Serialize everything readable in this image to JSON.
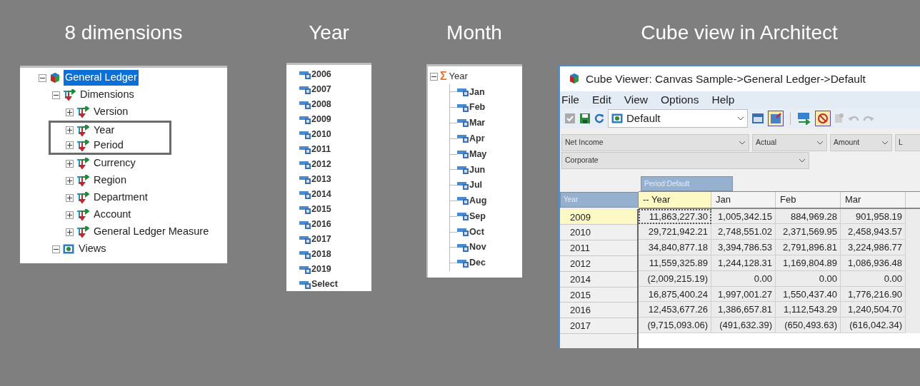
{
  "headings": [
    "8 dimensions",
    "Year",
    "Month",
    "Cube view in Architect"
  ],
  "tree": [
    {
      "label": "General Ledger",
      "kind": "cube",
      "selected": true,
      "expanded": true,
      "highlighted": false,
      "children": [
        {
          "label": "Dimensions",
          "kind": "dimension",
          "selected": false,
          "expanded": true,
          "highlighted": false,
          "children": [
            {
              "label": "Version",
              "kind": "dimension",
              "selected": false,
              "expanded": false,
              "highlighted": false
            },
            {
              "label": "Year",
              "kind": "dimension",
              "selected": false,
              "expanded": false,
              "highlighted": true
            },
            {
              "label": "Period",
              "kind": "dimension",
              "selected": false,
              "expanded": false,
              "highlighted": true
            },
            {
              "label": "Currency",
              "kind": "dimension",
              "selected": false,
              "expanded": false,
              "highlighted": false
            },
            {
              "label": "Region",
              "kind": "dimension",
              "selected": false,
              "expanded": false,
              "highlighted": false
            },
            {
              "label": "Department",
              "kind": "dimension",
              "selected": false,
              "expanded": false,
              "highlighted": false
            },
            {
              "label": "Account",
              "kind": "dimension",
              "selected": false,
              "expanded": false,
              "highlighted": false
            },
            {
              "label": "General Ledger Measure",
              "kind": "dimension",
              "selected": false,
              "expanded": false,
              "highlighted": false
            }
          ]
        },
        {
          "label": "Views",
          "kind": "view",
          "selected": false,
          "expanded": true,
          "highlighted": false
        }
      ]
    }
  ],
  "years": [
    "2006",
    "2007",
    "2008",
    "2009",
    "2010",
    "2011",
    "2012",
    "2013",
    "2014",
    "2015",
    "2016",
    "2017",
    "2018",
    "2019",
    "Select"
  ],
  "month_tree": {
    "glyph": "Σ",
    "label": "Year",
    "expanded": true,
    "children": [
      "Jan",
      "Feb",
      "Mar",
      "Apr",
      "May",
      "Jun",
      "Jul",
      "Aug",
      "Sep",
      "Oct",
      "Nov",
      "Dec"
    ]
  },
  "cube_viewer": {
    "title": "Cube Viewer: Canvas Sample->General Ledger->Default",
    "menu": [
      "File",
      "Edit",
      "View",
      "Options",
      "Help"
    ],
    "view_select": "Default",
    "filters": [
      "Net Income",
      "Actual",
      "Amount",
      "L"
    ],
    "filters_row2": [
      "Corporate"
    ],
    "column_dimension": "Period:Default",
    "row_dimension": "Year",
    "columns": [
      {
        "label": "-- Year",
        "selected": true
      },
      {
        "label": "Jan",
        "selected": false
      },
      {
        "label": "Feb",
        "selected": false
      },
      {
        "label": "Mar",
        "selected": false
      }
    ],
    "rows": [
      {
        "label": "2009",
        "selected": true,
        "cells": [
          "11,863,227.30",
          "1,005,342.15",
          "884,969.28",
          "901,958.19"
        ]
      },
      {
        "label": "2010",
        "selected": false,
        "cells": [
          "29,721,942.21",
          "2,748,551.02",
          "2,371,569.95",
          "2,458,943.57"
        ]
      },
      {
        "label": "2011",
        "selected": false,
        "cells": [
          "34,840,877.18",
          "3,394,786.53",
          "2,791,896.81",
          "3,224,986.77"
        ]
      },
      {
        "label": "2012",
        "selected": false,
        "cells": [
          "11,559,325.89",
          "1,244,128.31",
          "1,169,804.89",
          "1,086,936.48"
        ]
      },
      {
        "label": "2014",
        "selected": false,
        "cells": [
          "(2,009,215.19)",
          "0.00",
          "0.00",
          "0.00"
        ]
      },
      {
        "label": "2015",
        "selected": false,
        "cells": [
          "16,875,400.24",
          "1,997,001.27",
          "1,550,437.40",
          "1,776,216.90"
        ]
      },
      {
        "label": "2016",
        "selected": false,
        "cells": [
          "12,453,677.26",
          "1,386,657.81",
          "1,112,543.29",
          "1,240,504.70"
        ]
      },
      {
        "label": "2017",
        "selected": false,
        "cells": [
          "(9,715,093.06)",
          "(491,632.39)",
          "(650,493.63)",
          "(616,042.34)"
        ]
      }
    ]
  }
}
